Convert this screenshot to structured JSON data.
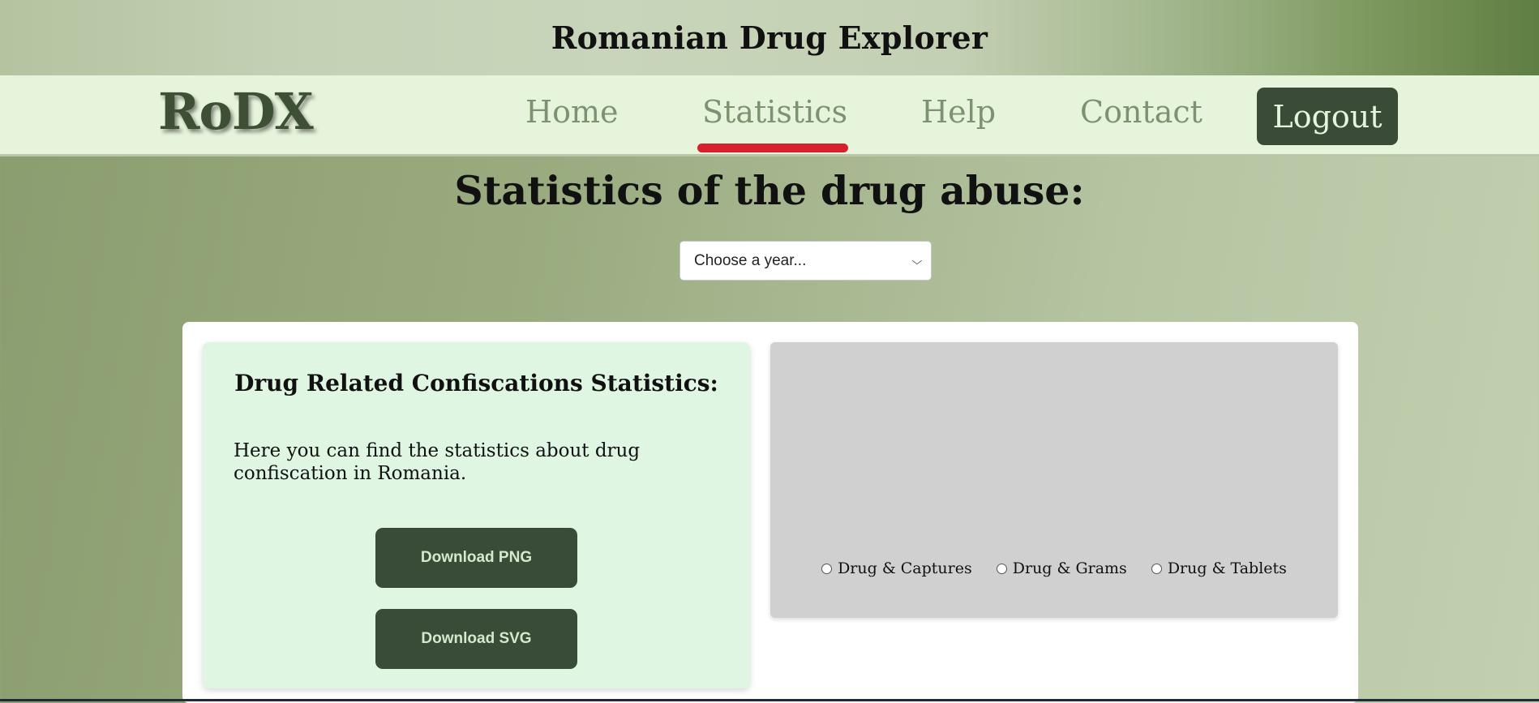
{
  "header": {
    "site_title": "Romanian Drug Explorer"
  },
  "nav": {
    "logo": "RoDX",
    "links": [
      {
        "label": "Home",
        "active": false
      },
      {
        "label": "Statistics",
        "active": true
      },
      {
        "label": "Help",
        "active": false
      },
      {
        "label": "Contact",
        "active": false
      }
    ],
    "logout_label": "Logout",
    "active_indicator_color": "#d81f2e"
  },
  "main": {
    "heading": "Statistics of the drug abuse:",
    "year_select": {
      "selected": "Choose a year..."
    },
    "info_card": {
      "title": "Drug Related Confiscations Statistics:",
      "description": "Here you can find the statistics about drug confiscation in Romania.",
      "download_png_label": "Download PNG",
      "download_svg_label": "Download SVG"
    },
    "chart_card": {
      "options": [
        {
          "label": "Drug & Captures",
          "checked": false
        },
        {
          "label": "Drug & Grams",
          "checked": false
        },
        {
          "label": "Drug & Tablets",
          "checked": false
        }
      ]
    }
  },
  "colors": {
    "button_dark_green": "#394c37",
    "navbar_bg": "#e7f4dc",
    "nav_link": "#7c9270",
    "info_card_bg": "#dff7e2",
    "chart_card_bg": "#d0d0d0"
  }
}
